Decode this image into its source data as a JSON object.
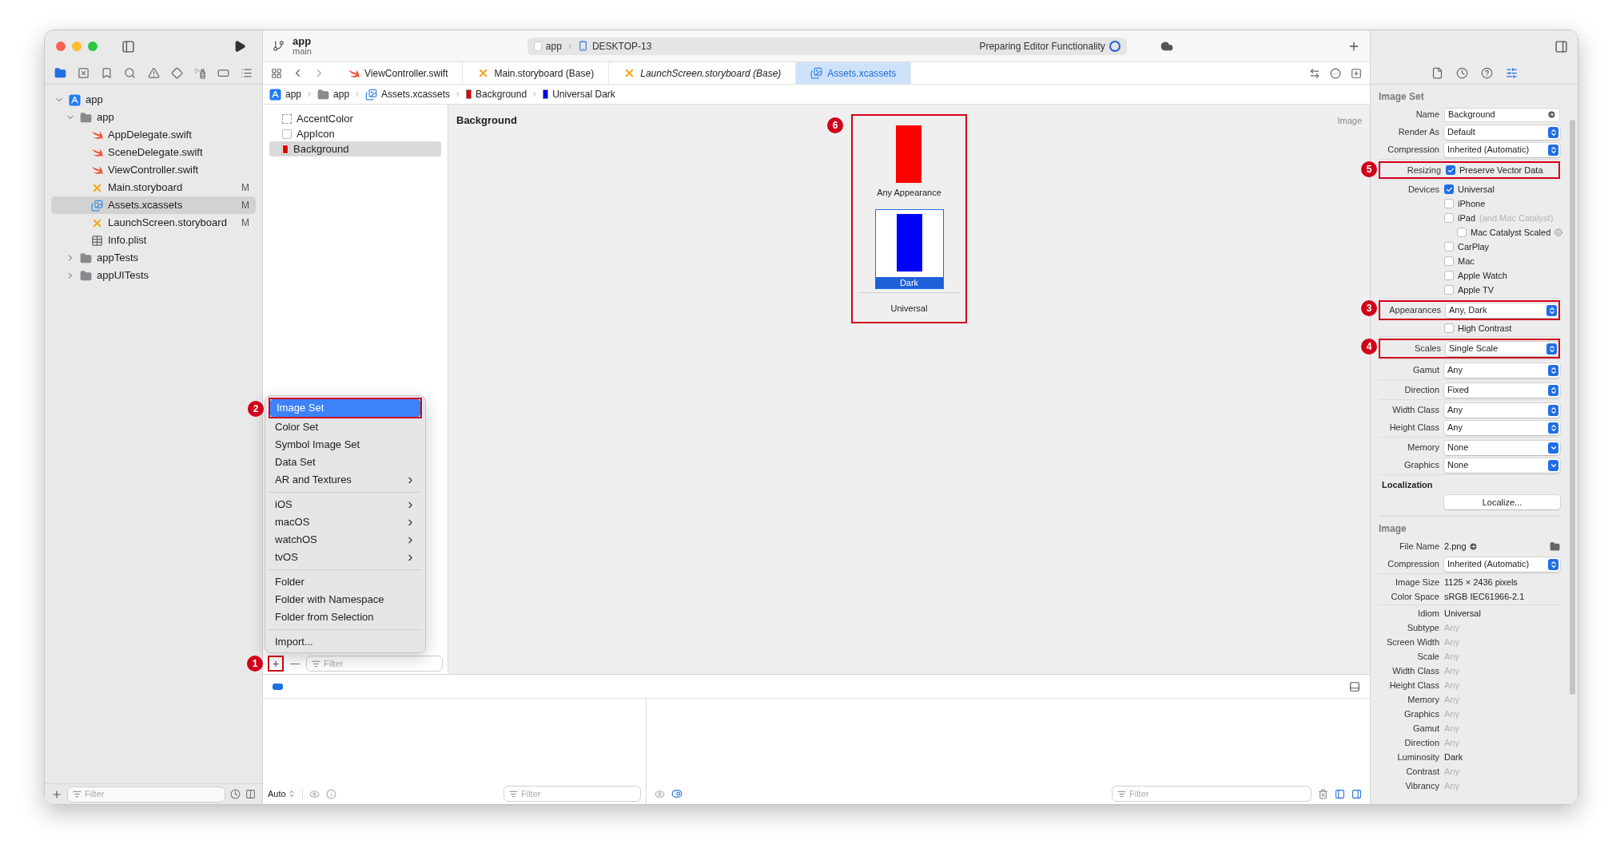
{
  "toolbar": {
    "project": "app",
    "branch": "main",
    "scheme": "app",
    "destination": "DESKTOP-13",
    "status": "Preparing Editor Functionality"
  },
  "navigator": {
    "tabs": [
      {
        "kind": "folder",
        "selected": true
      },
      {
        "kind": "source-control",
        "selected": false
      },
      {
        "kind": "bookmark",
        "selected": false
      },
      {
        "kind": "search",
        "selected": false
      },
      {
        "kind": "warning",
        "selected": false
      },
      {
        "kind": "test",
        "selected": false
      },
      {
        "kind": "debug",
        "selected": false
      },
      {
        "kind": "breakpoint",
        "selected": false
      },
      {
        "kind": "report",
        "selected": false
      }
    ],
    "tree": [
      {
        "label": "app",
        "kind": "project",
        "expanded": true,
        "selected": false,
        "children": [
          {
            "label": "app",
            "kind": "folder",
            "expanded": true,
            "selected": false,
            "children": [
              {
                "label": "AppDelegate.swift",
                "kind": "swift",
                "selected": false
              },
              {
                "label": "SceneDelegate.swift",
                "kind": "swift",
                "selected": false
              },
              {
                "label": "ViewController.swift",
                "kind": "swift",
                "selected": false
              },
              {
                "label": "Main.storyboard",
                "kind": "storyboard",
                "badge": "M",
                "selected": false
              },
              {
                "label": "Assets.xcassets",
                "kind": "assets",
                "badge": "M",
                "selected": true
              },
              {
                "label": "LaunchScreen.storyboard",
                "kind": "storyboard",
                "badge": "M",
                "selected": false
              },
              {
                "label": "Info.plist",
                "kind": "plist",
                "selected": false
              }
            ]
          },
          {
            "label": "appTests",
            "kind": "folder",
            "expanded": false,
            "selected": false
          },
          {
            "label": "appUITests",
            "kind": "folder",
            "expanded": false,
            "selected": false
          }
        ]
      }
    ],
    "filter_placeholder": "Filter"
  },
  "editor_tabs": [
    {
      "label": "ViewController.swift",
      "kind": "swift",
      "preview": false,
      "selected": false
    },
    {
      "label": "Main.storyboard (Base)",
      "kind": "storyboard",
      "preview": false,
      "selected": false
    },
    {
      "label": "LaunchScreen.storyboard (Base)",
      "kind": "storyboard",
      "preview": true,
      "selected": false
    },
    {
      "label": "Assets.xcassets",
      "kind": "assets",
      "preview": false,
      "selected": true
    }
  ],
  "breadcrumbs": [
    {
      "label": "app",
      "kind": "project"
    },
    {
      "label": "app",
      "kind": "folder"
    },
    {
      "label": "Assets.xcassets",
      "kind": "assets"
    },
    {
      "label": "Background",
      "kind": "swatch",
      "color": "#e00000"
    },
    {
      "label": "Universal Dark",
      "kind": "swatch",
      "color": "#0000e0"
    }
  ],
  "asset_list": {
    "items": [
      {
        "label": "AccentColor",
        "kind": "color-set",
        "selected": false
      },
      {
        "label": "AppIcon",
        "kind": "app-icon",
        "selected": false
      },
      {
        "label": "Background",
        "kind": "image-set",
        "selected": true
      }
    ],
    "add_button": {
      "label": "+",
      "callout": "1"
    },
    "remove_button": {
      "label": "—"
    },
    "filter_placeholder": "Filter",
    "add_menu": {
      "groups": [
        [
          {
            "label": "Image Set",
            "submenu": false,
            "selected": true,
            "callout": "2"
          },
          {
            "label": "Color Set",
            "submenu": false,
            "selected": false
          },
          {
            "label": "Symbol Image Set",
            "submenu": false,
            "selected": false
          },
          {
            "label": "Data Set",
            "submenu": false,
            "selected": false
          },
          {
            "label": "AR and Textures",
            "submenu": true,
            "selected": false
          }
        ],
        [
          {
            "label": "iOS",
            "submenu": true,
            "selected": false
          },
          {
            "label": "macOS",
            "submenu": true,
            "selected": false
          },
          {
            "label": "watchOS",
            "submenu": true,
            "selected": false
          },
          {
            "label": "tvOS",
            "submenu": true,
            "selected": false
          }
        ],
        [
          {
            "label": "Folder",
            "submenu": false,
            "selected": false
          },
          {
            "label": "Folder with Namespace",
            "submenu": false,
            "selected": false
          },
          {
            "label": "Folder from Selection",
            "submenu": false,
            "selected": false
          }
        ],
        [
          {
            "label": "Import...",
            "submenu": false,
            "selected": false
          }
        ]
      ]
    }
  },
  "canvas": {
    "title": "Background",
    "type_label": "Image",
    "callout": "6",
    "slots": [
      {
        "label": "Any Appearance",
        "color": "#ff0000",
        "selected": false
      },
      {
        "label": "Dark",
        "color": "#0000ff",
        "selected": true
      }
    ],
    "footer": "Universal"
  },
  "debug": {
    "console_mode": "Auto",
    "variables_filter_placeholder": "Filter",
    "console_filter_placeholder": "Filter"
  },
  "inspector": {
    "tabs": [
      {
        "kind": "file",
        "selected": false
      },
      {
        "kind": "history",
        "selected": false
      },
      {
        "kind": "help",
        "selected": false
      },
      {
        "kind": "attributes",
        "selected": true
      }
    ],
    "sections": [
      {
        "title": "Image Set",
        "groups": [
          [
            {
              "kind": "field",
              "label": "Name",
              "value": "Background"
            },
            {
              "kind": "popup",
              "label": "Render As",
              "value": "Default"
            },
            {
              "kind": "popup",
              "label": "Compression",
              "value": "Inherited (Automatic)"
            }
          ],
          [
            {
              "kind": "checks",
              "label": "Resizing",
              "callout": "5",
              "options": [
                {
                  "label": "Preserve Vector Data",
                  "checked": true
                }
              ]
            }
          ],
          [
            {
              "kind": "checks",
              "label": "Devices",
              "options": [
                {
                  "label": "Universal",
                  "checked": true
                },
                {
                  "label": "iPhone",
                  "checked": false
                },
                {
                  "label": "iPad",
                  "note": "(and Mac Catalyst)",
                  "checked": false,
                  "children": [
                    {
                      "label": "Mac Catalyst Scaled",
                      "checked": false,
                      "info": true
                    }
                  ]
                },
                {
                  "label": "CarPlay",
                  "checked": false
                },
                {
                  "label": "Mac",
                  "checked": false
                },
                {
                  "label": "Apple Watch",
                  "checked": false
                },
                {
                  "label": "Apple TV",
                  "checked": false
                }
              ]
            }
          ],
          [
            {
              "kind": "popup",
              "label": "Appearances",
              "value": "Any, Dark",
              "callout": "3"
            },
            {
              "kind": "checks",
              "options": [
                {
                  "label": "High Contrast",
                  "checked": false
                }
              ]
            }
          ],
          [
            {
              "kind": "popup",
              "label": "Scales",
              "value": "Single Scale",
              "callout": "4"
            }
          ],
          [
            {
              "kind": "popup",
              "label": "Gamut",
              "value": "Any"
            }
          ],
          [
            {
              "kind": "popup",
              "label": "Direction",
              "value": "Fixed"
            }
          ],
          [
            {
              "kind": "popup",
              "label": "Width Class",
              "value": "Any"
            },
            {
              "kind": "popup",
              "label": "Height Class",
              "value": "Any"
            }
          ],
          [
            {
              "kind": "menu",
              "label": "Memory",
              "value": "None"
            },
            {
              "kind": "menu",
              "label": "Graphics",
              "value": "None"
            }
          ],
          [
            {
              "kind": "heading",
              "label": "Localization"
            },
            {
              "kind": "button",
              "value": "Localize..."
            }
          ]
        ]
      },
      {
        "title": "Image",
        "groups": [
          [
            {
              "kind": "file",
              "label": "File Name",
              "value": "2.png"
            },
            {
              "kind": "popup",
              "label": "Compression",
              "value": "Inherited (Automatic)"
            }
          ],
          [
            {
              "kind": "info",
              "label": "Image Size",
              "value": "1125 × 2436 pixels",
              "muted": false
            },
            {
              "kind": "info",
              "label": "Color Space",
              "value": "sRGB IEC61966-2.1",
              "muted": false
            }
          ],
          [
            {
              "kind": "info",
              "label": "Idiom",
              "value": "Universal",
              "muted": false
            },
            {
              "kind": "info",
              "label": "Subtype",
              "value": "Any",
              "muted": true
            },
            {
              "kind": "info",
              "label": "Screen Width",
              "value": "Any",
              "muted": true
            },
            {
              "kind": "info",
              "label": "Scale",
              "value": "Any",
              "muted": true
            },
            {
              "kind": "info",
              "label": "Width Class",
              "value": "Any",
              "muted": true
            },
            {
              "kind": "info",
              "label": "Height Class",
              "value": "Any",
              "muted": true
            },
            {
              "kind": "info",
              "label": "Memory",
              "value": "Any",
              "muted": true
            },
            {
              "kind": "info",
              "label": "Graphics",
              "value": "Any",
              "muted": true
            },
            {
              "kind": "info",
              "label": "Gamut",
              "value": "Any",
              "muted": true
            },
            {
              "kind": "info",
              "label": "Direction",
              "value": "Any",
              "muted": true
            },
            {
              "kind": "info",
              "label": "Luminosity",
              "value": "Dark",
              "muted": false
            },
            {
              "kind": "info",
              "label": "Contrast",
              "value": "Any",
              "muted": true
            },
            {
              "kind": "info",
              "label": "Vibrancy",
              "value": "Any",
              "muted": true
            }
          ]
        ]
      }
    ]
  }
}
